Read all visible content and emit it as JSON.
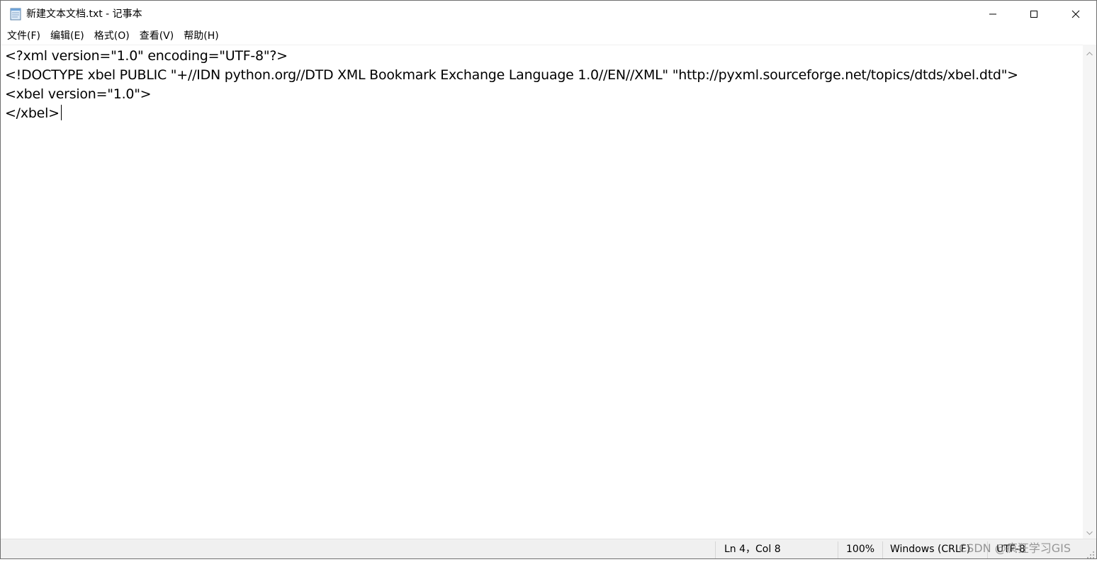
{
  "window": {
    "title": "新建文本文档.txt - 记事本",
    "icon": "notepad-icon",
    "controls": [
      "minimize-icon",
      "maximize-icon",
      "close-icon"
    ]
  },
  "menu": {
    "items": [
      "文件(F)",
      "编辑(E)",
      "格式(O)",
      "查看(V)",
      "帮助(H)"
    ]
  },
  "editor": {
    "lines": [
      "<?xml version=\"1.0\" encoding=\"UTF-8\"?>",
      "<!DOCTYPE xbel PUBLIC \"+//IDN python.org//DTD XML Bookmark Exchange Language 1.0//EN//XML\" \"http://pyxml.sourceforge.net/topics/dtds/xbel.dtd\">",
      "<xbel version=\"1.0\">",
      "</xbel>"
    ]
  },
  "status": {
    "position": "Ln 4，Col 8",
    "zoom": "100%",
    "line_ending": "Windows (CRLF)",
    "encoding": "UTF-8"
  },
  "watermark": "CSDN @疯狂学习GIS",
  "colors": {
    "statusbar_bg": "#f0f0f0",
    "scrollbar_bg": "#f5f5f5",
    "window_border": "#6f6f6f"
  }
}
